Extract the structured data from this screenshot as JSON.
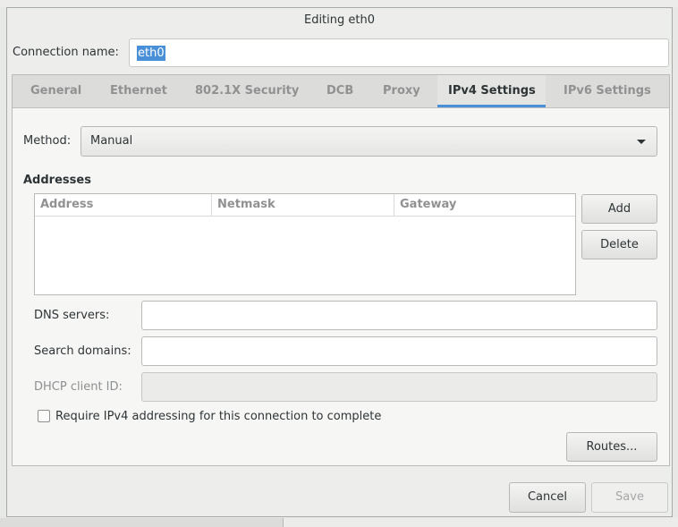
{
  "window": {
    "title": "Editing eth0"
  },
  "connection": {
    "label": "Connection name:",
    "value": "eth0"
  },
  "tabs": [
    {
      "label": "General"
    },
    {
      "label": "Ethernet"
    },
    {
      "label": "802.1X Security"
    },
    {
      "label": "DCB"
    },
    {
      "label": "Proxy"
    },
    {
      "label": "IPv4 Settings",
      "active": true
    },
    {
      "label": "IPv6 Settings"
    }
  ],
  "ipv4": {
    "method_label": "Method:",
    "method_value": "Manual",
    "addresses_heading": "Addresses",
    "columns": [
      "Address",
      "Netmask",
      "Gateway"
    ],
    "add_label": "Add",
    "delete_label": "Delete",
    "dns_label": "DNS servers:",
    "dns_value": "",
    "search_label": "Search domains:",
    "search_value": "",
    "dhcp_label": "DHCP client ID:",
    "dhcp_value": "",
    "require_label": "Require IPv4 addressing for this connection to complete",
    "require_checked": false,
    "routes_label": "Routes..."
  },
  "footer": {
    "cancel_label": "Cancel",
    "save_label": "Save"
  },
  "colors": {
    "accent": "#4a90d9",
    "dialog_bg": "#ededec",
    "tabbar_bg": "#dcdcdb"
  }
}
